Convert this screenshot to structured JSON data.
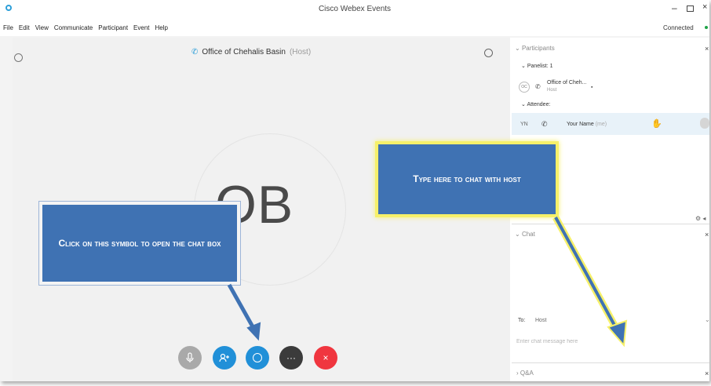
{
  "window": {
    "title": "Cisco Webex Events",
    "minimize": "–",
    "close": "×"
  },
  "menu": {
    "items": [
      "File",
      "Edit",
      "View",
      "Communicate",
      "Participant",
      "Event",
      "Help"
    ],
    "status": "Connected"
  },
  "stage": {
    "presenter_name": "Office of Chehalis Basin",
    "presenter_role": "(Host)",
    "avatar_initials": "OB"
  },
  "controls": {
    "more": "···",
    "leave": "×"
  },
  "panel": {
    "participants_title": "Participants",
    "panelist_label": "Panelist: 1",
    "host_initials": "OC",
    "host_name": "Office of Cheh...",
    "host_sub": "Host",
    "attendee_label": "Attendee:",
    "attendee_initials": "YN",
    "attendee_name": "Your Name",
    "attendee_me": "(me)",
    "chat_title": "Chat",
    "to_label": "To:",
    "to_value": "Host",
    "chat_placeholder": "Enter chat message here",
    "qa_title": "Q&A"
  },
  "annotations": {
    "left": "Click on this symbol to open the chat box",
    "right": "Type here to chat with host"
  },
  "colors": {
    "accent": "#2190d8",
    "leave": "#f0363f",
    "callout": "#3f72b3",
    "highlight": "#f6f06a"
  }
}
